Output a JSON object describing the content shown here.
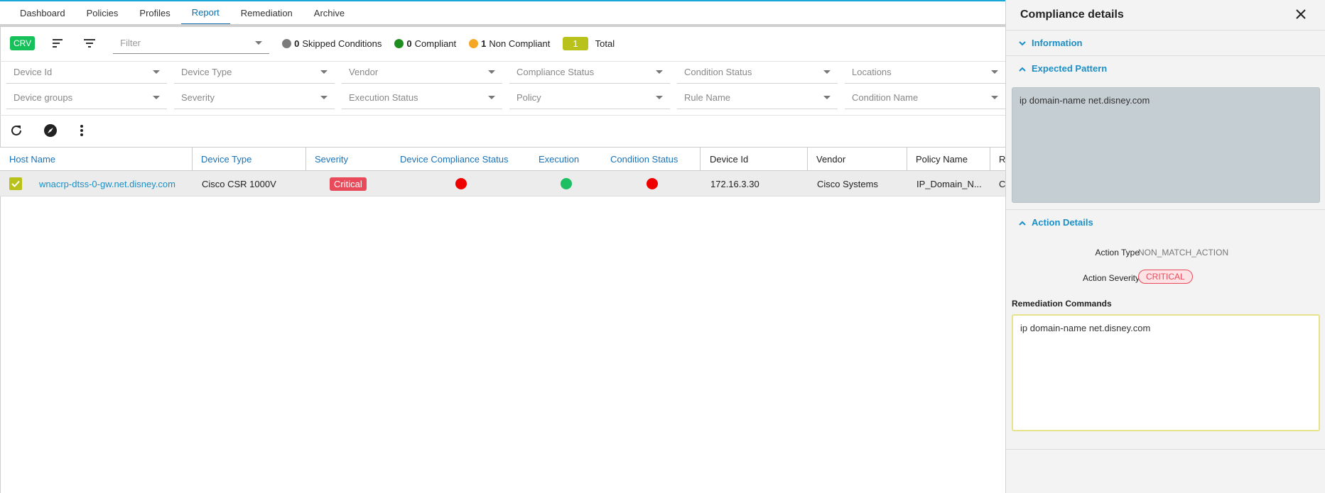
{
  "nav": {
    "tabs": [
      "Dashboard",
      "Policies",
      "Profiles",
      "Report",
      "Remediation",
      "Archive"
    ],
    "active": "Report"
  },
  "summary": {
    "crv_label": "CRV",
    "filter_placeholder": "Filter",
    "skipped_count": "0",
    "skipped_label": "Skipped Conditions",
    "compliant_count": "0",
    "compliant_label": "Compliant",
    "noncompliant_count": "1",
    "noncompliant_label": "Non Compliant",
    "total_count": "1",
    "total_label": "Total",
    "colors": {
      "skipped": "#7b7b7b",
      "compliant": "#1e8e1e",
      "noncompliant": "#f5a623",
      "crv": "#16c15a",
      "total": "#b9c21a"
    }
  },
  "filters": {
    "row1": [
      "Device Id",
      "Device Type",
      "Vendor",
      "Compliance Status",
      "Condition Status",
      "Locations"
    ],
    "row2": [
      "Device groups",
      "Severity",
      "Execution Status",
      "Policy",
      "Rule Name",
      "Condition Name"
    ]
  },
  "table": {
    "headers": [
      "Host Name",
      "Device Type",
      "Severity",
      "Device Compliance Status",
      "Execution",
      "Condition Status",
      "Device Id",
      "Vendor",
      "Policy Name",
      "R"
    ],
    "rows": [
      {
        "host": "wnacrp-dtss-0-gw.net.disney.com",
        "device_type": "Cisco CSR 1000V",
        "severity": "Critical",
        "device_compliance_status": "red",
        "execution": "green",
        "condition_status": "red",
        "device_id": "172.16.3.30",
        "vendor": "Cisco Systems",
        "policy_name": "IP_Domain_N...",
        "r": "C"
      }
    ]
  },
  "panel": {
    "title": "Compliance details",
    "information_label": "Information",
    "expected_label": "Expected Pattern",
    "expected_value": "ip domain-name net.disney.com",
    "action_label": "Action Details",
    "action_type_label": "Action Type",
    "action_type_value": "NON_MATCH_ACTION",
    "action_severity_label": "Action Severity",
    "action_severity_value": "CRITICAL",
    "remediation_label": "Remediation Commands",
    "remediation_value": "ip domain-name net.disney.com"
  }
}
